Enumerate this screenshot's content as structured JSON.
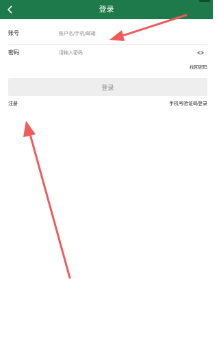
{
  "header": {
    "title": "登录",
    "back_icon": "back-arrow-icon",
    "bg_color": "#1f7a4b"
  },
  "form": {
    "account_label": "账号",
    "account_placeholder": "账户名/手机/邮箱",
    "password_label": "密码",
    "password_placeholder": "请输入密码",
    "eye_icon": "eye-icon",
    "forgot_label": "找回密码"
  },
  "login_button": {
    "label": "登录"
  },
  "links": {
    "register": "注册",
    "sms_login": "手机号验证码登录"
  },
  "annotations": {
    "color": "#f05a5a",
    "count": 2
  }
}
